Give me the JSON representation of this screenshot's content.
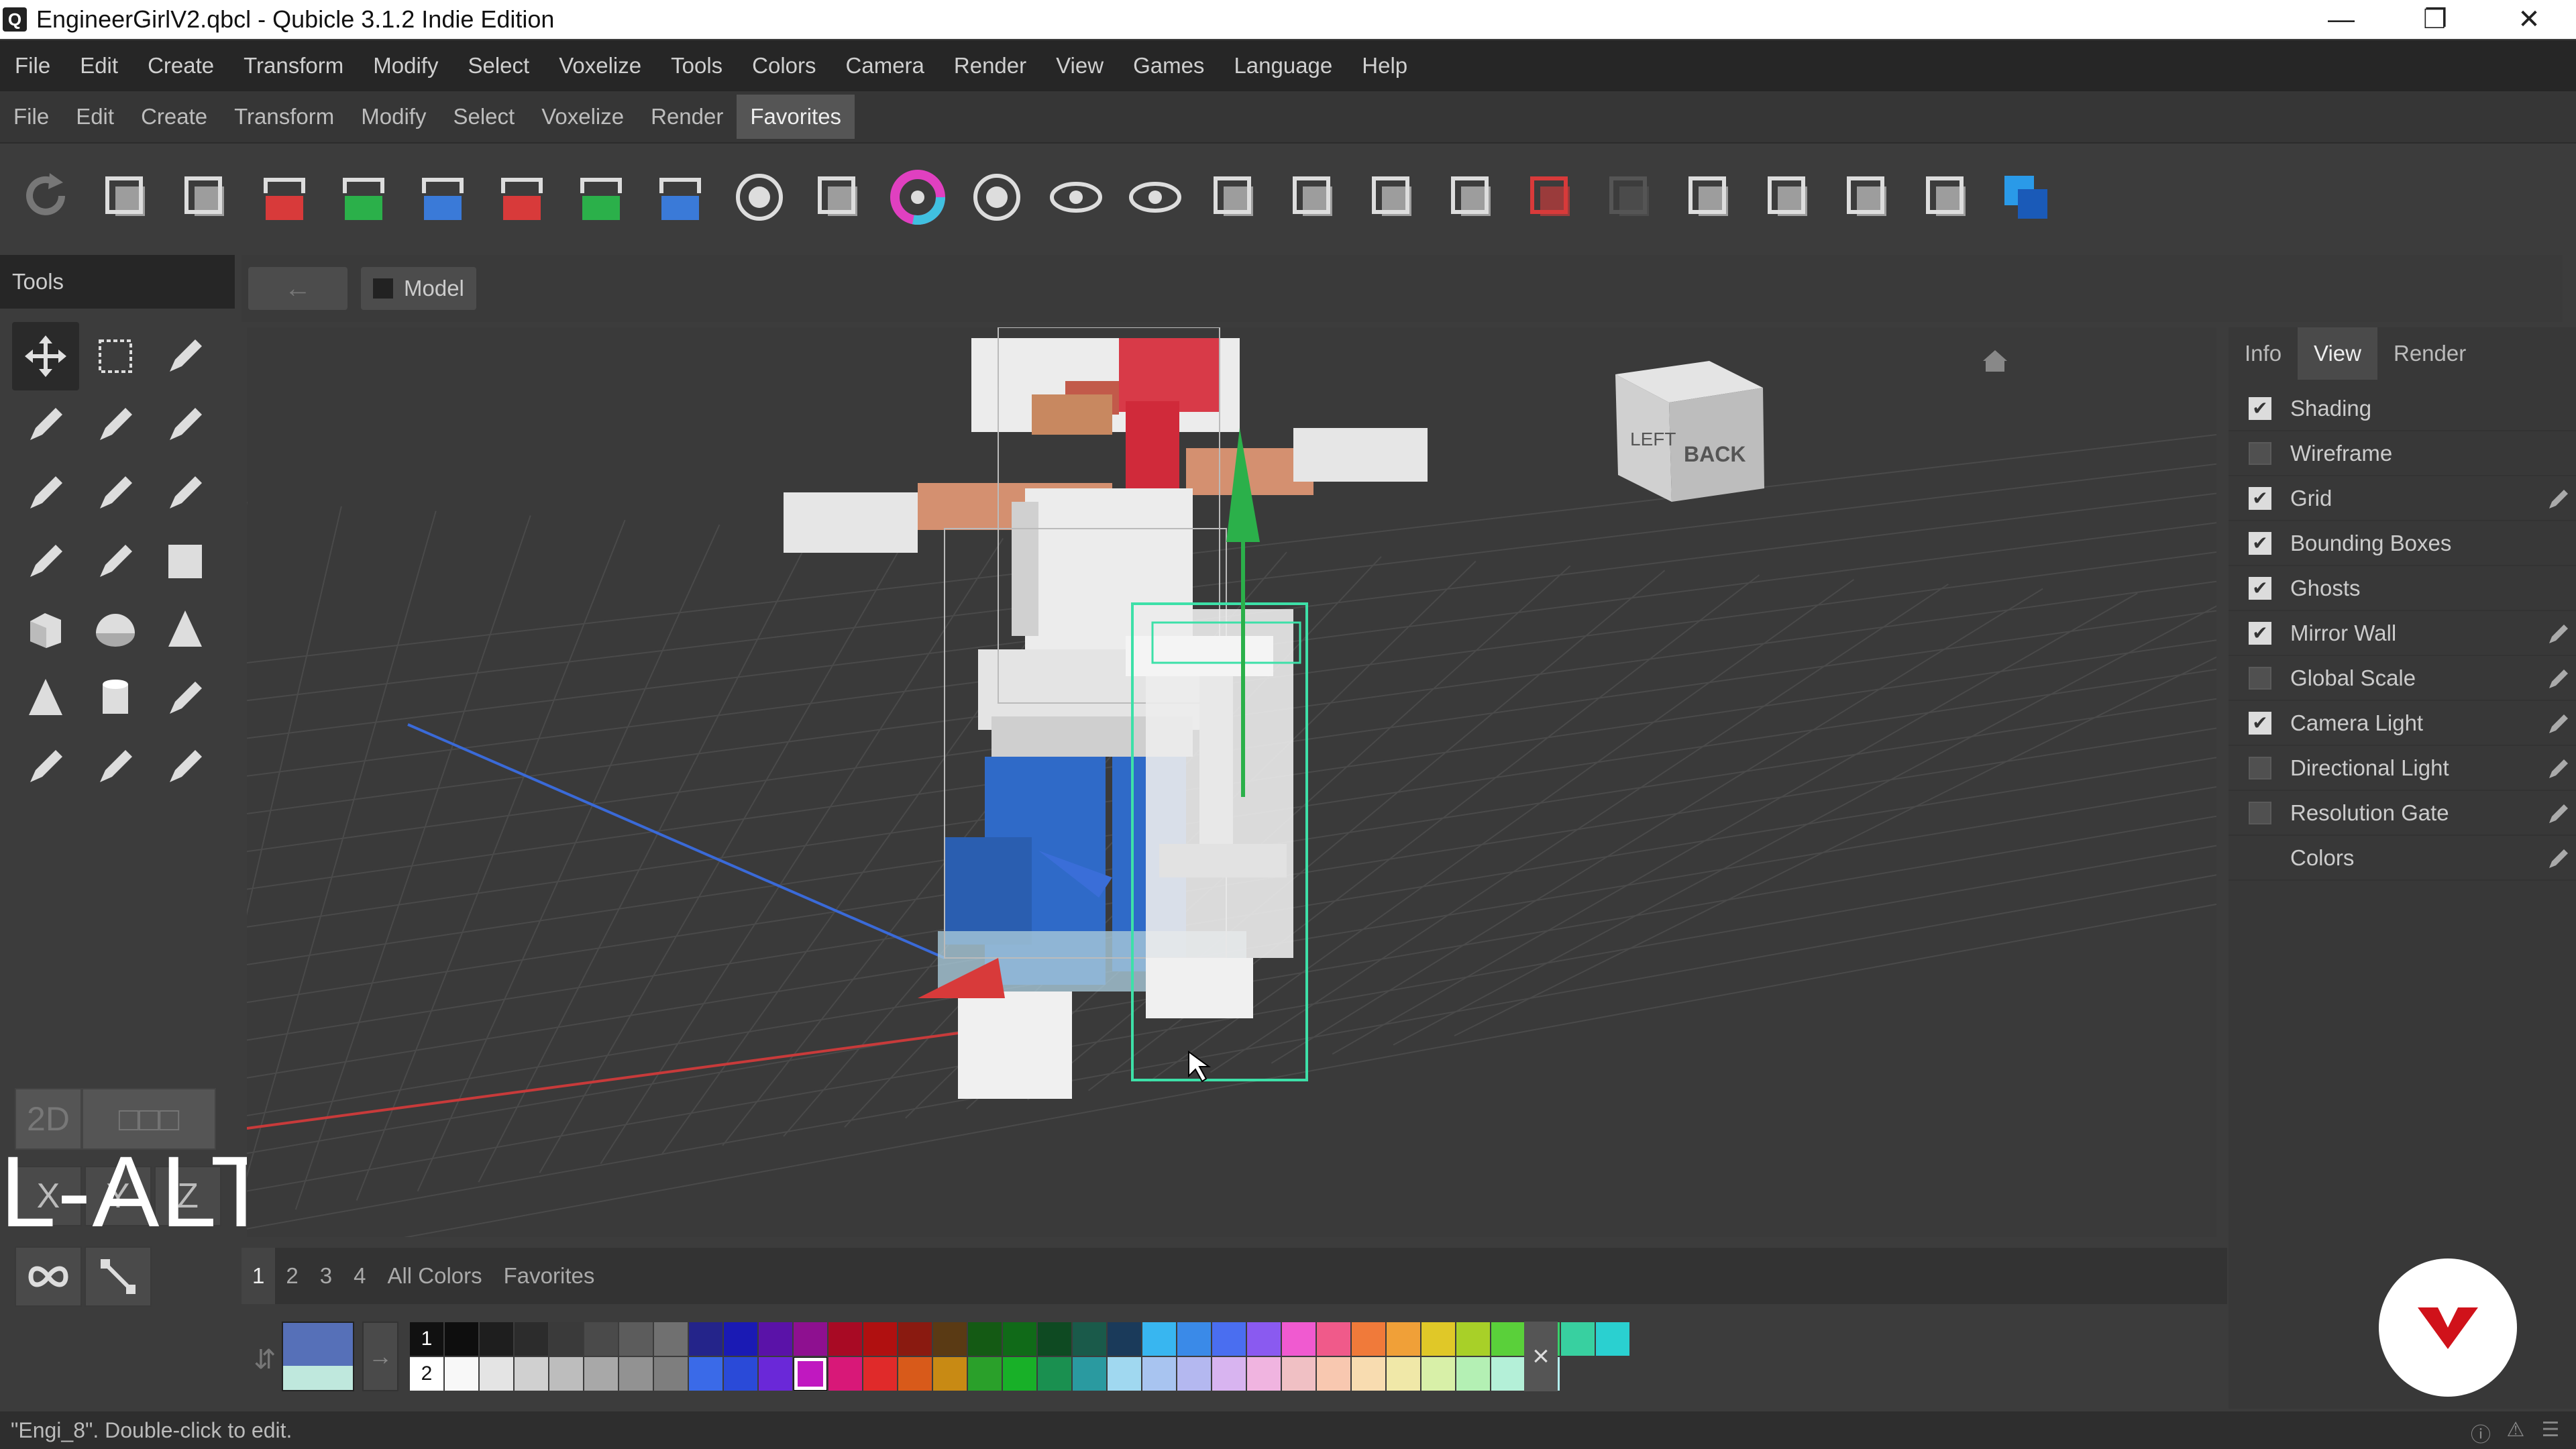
{
  "window": {
    "title": "EngineerGirlV2.qbcl - Qubicle 3.1.2 Indie Edition",
    "app_icon": "qubicle-logo-icon"
  },
  "menu_main": [
    "File",
    "Edit",
    "Create",
    "Transform",
    "Modify",
    "Select",
    "Voxelize",
    "Tools",
    "Colors",
    "Camera",
    "Render",
    "View",
    "Games",
    "Language",
    "Help"
  ],
  "menu_secondary": [
    "File",
    "Edit",
    "Create",
    "Transform",
    "Modify",
    "Select",
    "Voxelize",
    "Render",
    "Favorites"
  ],
  "menu_secondary_active": "Favorites",
  "toolbar_icons": [
    "redo-icon",
    "copy-icon",
    "duplicate-icon",
    "mirror-x-icon",
    "mirror-y-icon",
    "mirror-z-icon",
    "flip-x-icon",
    "flip-y-icon",
    "flip-z-icon",
    "center-icon",
    "merge-icon",
    "color-wheel-icon",
    "hollow-icon",
    "show-icon",
    "hide-icon",
    "ruler-icon",
    "measure-icon",
    "scale-2x-icon",
    "symmetry-icon",
    "boolean-icon",
    "grid-fill-icon",
    "rotate-icon",
    "cube-icon",
    "fit-icon",
    "fullscreen-icon",
    "layers-icon"
  ],
  "tools": {
    "header": "Tools",
    "items": [
      "move-icon",
      "marquee-select-icon",
      "color-picker-icon",
      "pencil-icon",
      "add-pencil-icon",
      "eraser-icon",
      "brush-icon",
      "fill-bucket-icon",
      "magic-wand-icon",
      "lasso-icon",
      "polygon-lasso-icon",
      "rectangle-icon",
      "cube-icon",
      "sphere-icon",
      "cone-icon",
      "pyramid-icon",
      "cylinder-icon",
      "stairs-icon",
      "paint-select-icon",
      "grow-icon",
      "scale-icon"
    ],
    "symmetry_2d": "2D",
    "axes": [
      "X",
      "Y",
      "Z"
    ]
  },
  "overlay_key": "L-ALT",
  "viewport": {
    "back_label": "←",
    "breadcrumb": "Model",
    "view_cube": {
      "left": "LEFT",
      "back": "BACK"
    }
  },
  "right_panel": {
    "tabs": [
      "Info",
      "View",
      "Render"
    ],
    "active_tab": "View",
    "options": [
      {
        "label": "Shading",
        "checked": true,
        "edit": false
      },
      {
        "label": "Wireframe",
        "checked": false,
        "edit": false
      },
      {
        "label": "Grid",
        "checked": true,
        "edit": true
      },
      {
        "label": "Bounding Boxes",
        "checked": true,
        "edit": false
      },
      {
        "label": "Ghosts",
        "checked": true,
        "edit": false
      },
      {
        "label": "Mirror Wall",
        "checked": true,
        "edit": true
      },
      {
        "label": "Global Scale",
        "checked": false,
        "edit": true
      },
      {
        "label": "Camera Light",
        "checked": true,
        "edit": true
      },
      {
        "label": "Directional Light",
        "checked": false,
        "edit": true
      },
      {
        "label": "Resolution Gate",
        "checked": false,
        "edit": true
      },
      {
        "label": "Colors",
        "checked": null,
        "edit": true
      }
    ]
  },
  "palette": {
    "tabs": [
      "1",
      "2",
      "3",
      "4",
      "All Colors",
      "Favorites"
    ],
    "active_tab": "1",
    "primary_color": "#5670b8",
    "secondary_color": "#bfe8dd",
    "row1_label": "1",
    "row2_label": "2",
    "row1": [
      "#0e0e0e",
      "#1e1e1e",
      "#2c2c2c",
      "#3a3a3a",
      "#4a4a4a",
      "#5c5c5c",
      "#707070",
      "#24248a",
      "#1a1ab4",
      "#5a12a8",
      "#8e1090",
      "#a80a24",
      "#b01010",
      "#8a1a10",
      "#5a3a14",
      "#145a14",
      "#106a18",
      "#0e4a22",
      "#1a5a4a",
      "#1a3a5a",
      "#38b6f0",
      "#3a8ae8",
      "#4a6ef0",
      "#8a5af0",
      "#f05ad0",
      "#f05a8a",
      "#f07a3a",
      "#f0a038",
      "#e0c828",
      "#a8d028",
      "#5ad03a",
      "#38d06a",
      "#38d0a0",
      "#2ad0d0"
    ],
    "row2": [
      "#f8f8f8",
      "#e4e4e4",
      "#d0d0d0",
      "#bdbdbd",
      "#a8a8a8",
      "#929292",
      "#7e7e7e",
      "#3a6ae8",
      "#2a4ad8",
      "#6a28d8",
      "#c018c0",
      "#d81878",
      "#e02a2a",
      "#d85a1a",
      "#c88a14",
      "#2aa02a",
      "#18b028",
      "#1a9050",
      "#2a9aa0",
      "#a0d8f0",
      "#a8c4f0",
      "#b4b8f0",
      "#d8b4f0",
      "#f0b4e0",
      "#f0c0c4",
      "#f8c8b0",
      "#f8dcb0",
      "#f0e8a8",
      "#d8f0a8",
      "#b4f0b4",
      "#b4f0d8",
      "#b4f0f0"
    ],
    "selected_row2_index": 10,
    "close_label": "×"
  },
  "status_text": "\"Engi_8\". Double-click to edit.",
  "colors": {
    "accent": "#5670b8",
    "selection_green": "#3de0a8",
    "axis_red": "#d83a3a",
    "axis_blue": "#3a6ed8",
    "axis_green": "#2bb04a"
  }
}
